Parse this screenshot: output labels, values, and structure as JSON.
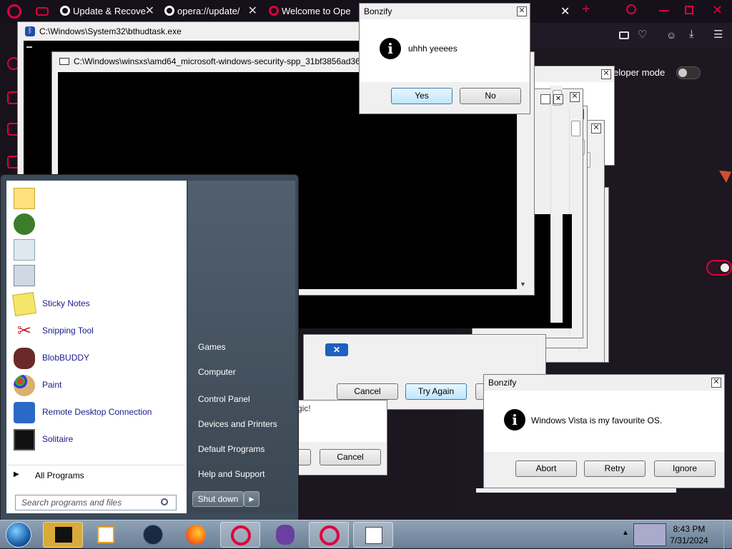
{
  "opera": {
    "tabs": [
      {
        "label": "Update & Recove"
      },
      {
        "label": "opera://update/"
      },
      {
        "label": "Welcome to Ope"
      }
    ],
    "dev_mode_label": "eloper mode"
  },
  "console1": {
    "title": "C:\\Windows\\System32\\bthudtask.exe"
  },
  "console2": {
    "title": "C:\\Windows\\winsxs\\amd64_microsoft-windows-security-spp_31bf3856ad36"
  },
  "bonzify1": {
    "title": "Bonzify",
    "message": "uhhh yeeees",
    "yes_label": "Yes",
    "no_label": "No"
  },
  "bonzify2": {
    "title": "Bonzify",
    "message": "Windows Vista is my favourite OS.",
    "abort_label": "Abort",
    "retry_label": "Retry",
    "ignore_label": "Ignore"
  },
  "hidden_dialog": {
    "cancel_label": "Cancel",
    "try_again_label": "Try Again",
    "partial_text": "Joel, it's magic!",
    "cancel2_label": "Cancel"
  },
  "start_menu": {
    "programs": [
      {
        "label": "Sticky Notes",
        "icon": "sticky-notes-icon"
      },
      {
        "label": "Snipping Tool",
        "icon": "scissors-icon"
      },
      {
        "label": "BlobBUDDY",
        "icon": "blob-icon"
      },
      {
        "label": "Paint",
        "icon": "paint-palette-icon"
      },
      {
        "label": "Remote Desktop Connection",
        "icon": "remote-desktop-icon"
      },
      {
        "label": "Solitaire",
        "icon": "cards-icon"
      }
    ],
    "all_programs": "All Programs",
    "search_placeholder": "Search programs and files",
    "right_items": [
      "Games",
      "Computer",
      "Control Panel",
      "Devices and Printers",
      "Default Programs",
      "Help and Support"
    ],
    "shutdown_label": "Shut down"
  },
  "taskbar": {
    "time": "8:43 PM",
    "date": "7/31/2024"
  }
}
